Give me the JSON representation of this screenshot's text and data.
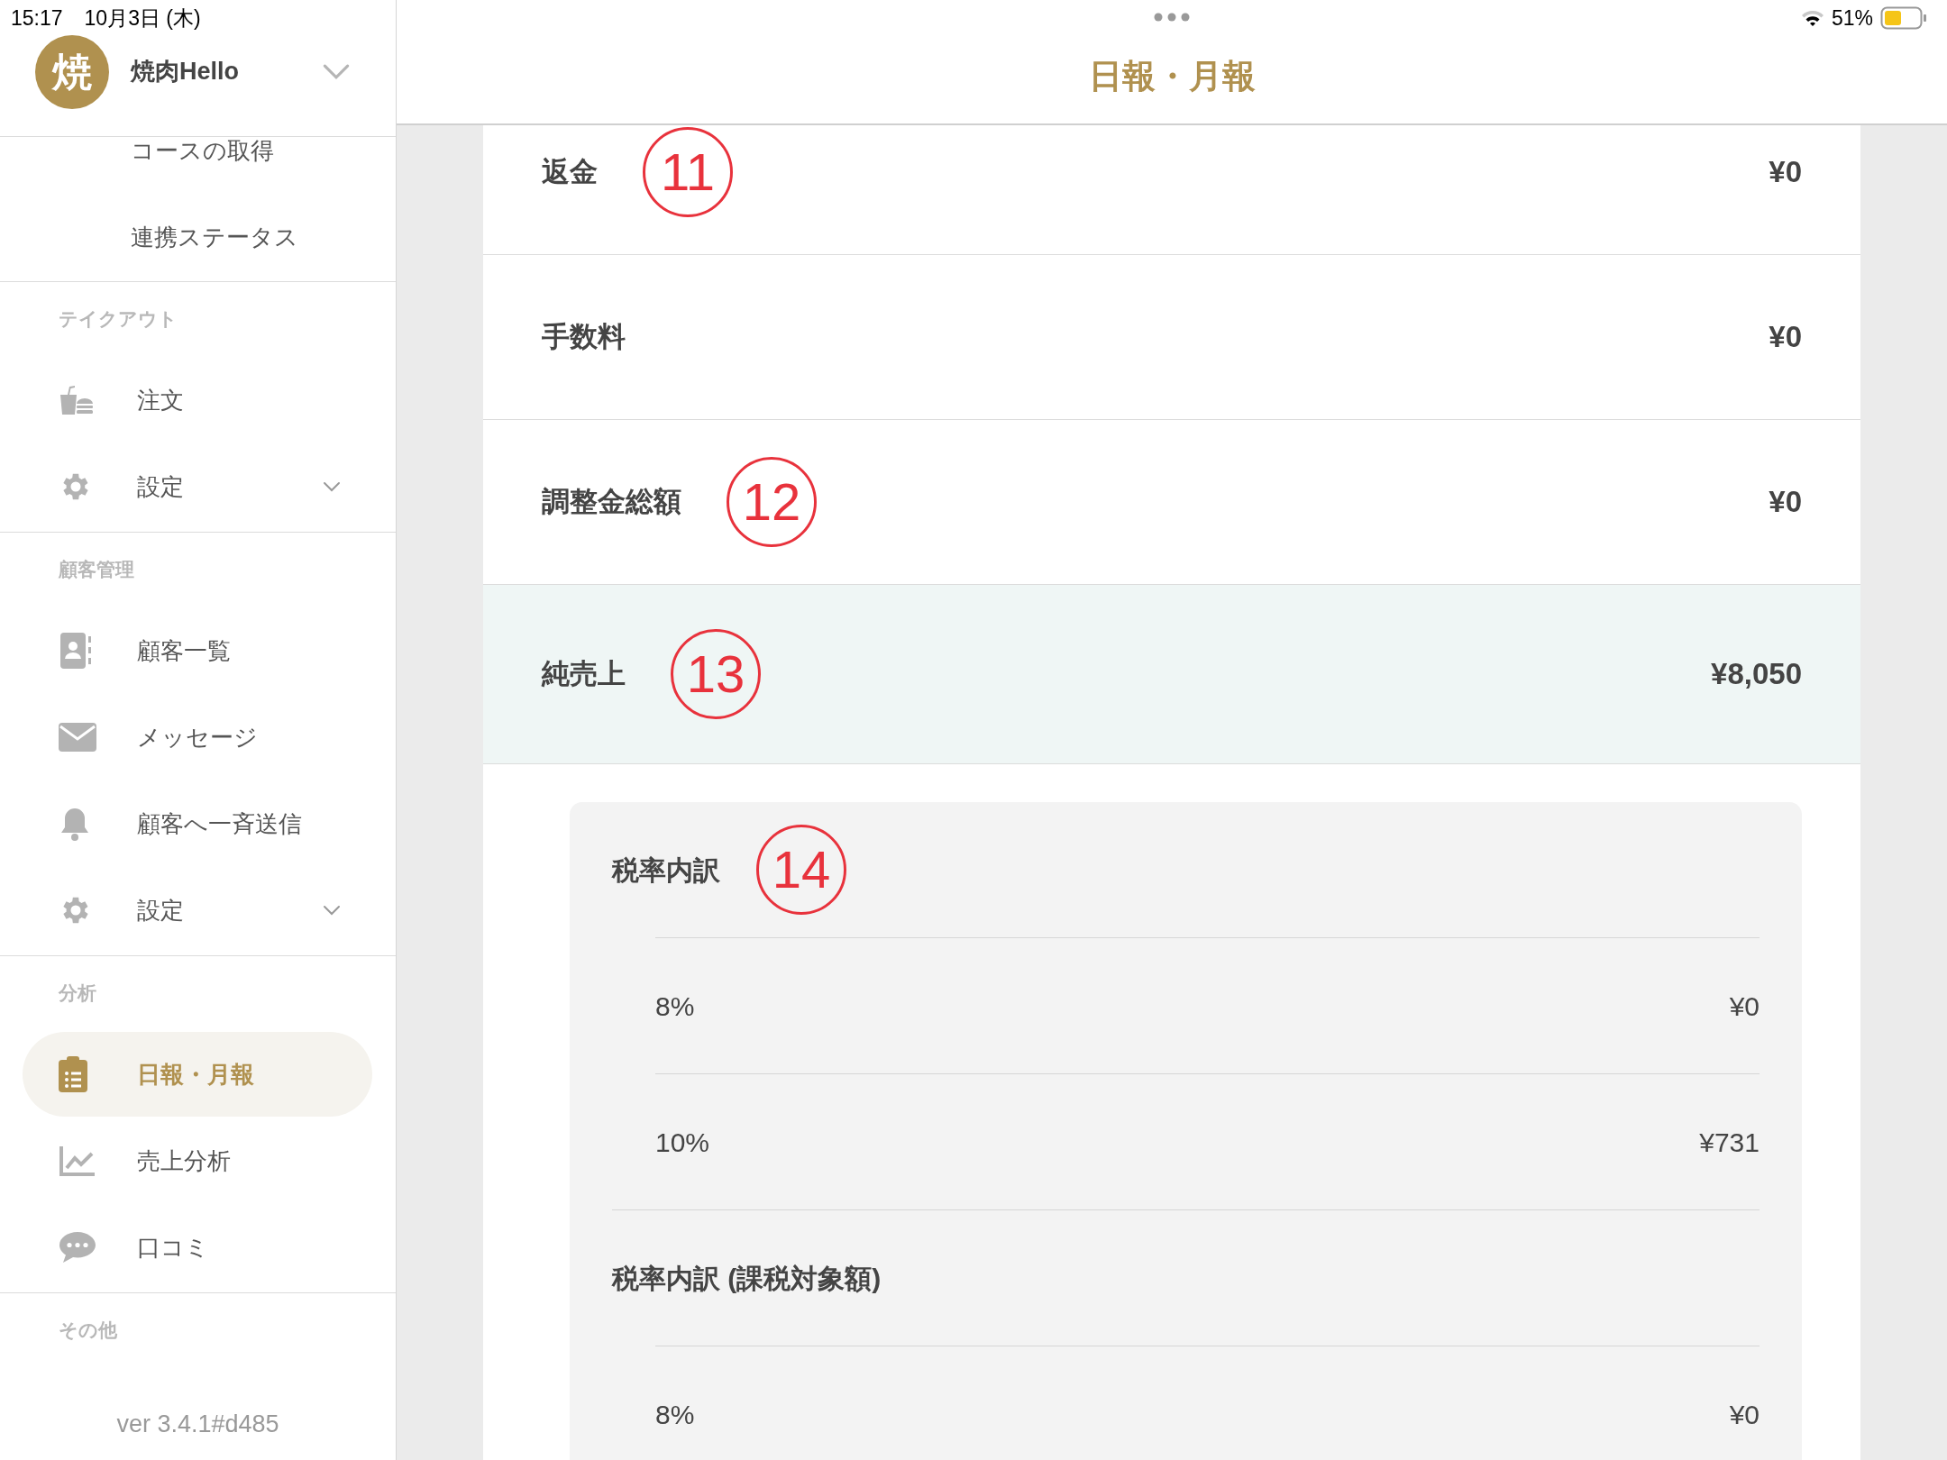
{
  "status_bar": {
    "time": "15:17",
    "date": "10月3日 (木)",
    "battery": "51%"
  },
  "sidebar": {
    "account": {
      "avatar": "焼",
      "name": "焼肉Hello"
    },
    "top_items": [
      {
        "label": "コースの取得"
      },
      {
        "label": "連携ステータス"
      }
    ],
    "sections": [
      {
        "title": "テイクアウト",
        "items": [
          {
            "label": "注文",
            "kind": "link",
            "selected": false
          },
          {
            "label": "設定",
            "kind": "expandable",
            "selected": false
          }
        ]
      },
      {
        "title": "顧客管理",
        "items": [
          {
            "label": "顧客一覧",
            "kind": "link",
            "selected": false
          },
          {
            "label": "メッセージ",
            "kind": "link",
            "selected": false
          },
          {
            "label": "顧客へ一斉送信",
            "kind": "link",
            "selected": false
          },
          {
            "label": "設定",
            "kind": "expandable",
            "selected": false
          }
        ]
      },
      {
        "title": "分析",
        "items": [
          {
            "label": "日報・月報",
            "kind": "link",
            "selected": true
          },
          {
            "label": "売上分析",
            "kind": "link",
            "selected": false
          },
          {
            "label": "口コミ",
            "kind": "link",
            "selected": false
          }
        ]
      },
      {
        "title": "その他"
      }
    ],
    "version": "ver 3.4.1#d485"
  },
  "header": {
    "title": "日報・月報"
  },
  "rows": [
    {
      "label": "返金",
      "value": "¥0",
      "highlighted": false,
      "marker": "11"
    },
    {
      "label": "手数料",
      "value": "¥0",
      "highlighted": false
    },
    {
      "label": "調整金総額",
      "value": "¥0",
      "highlighted": false,
      "marker": "12"
    },
    {
      "label": "純売上",
      "value": "¥8,050",
      "highlighted": true,
      "marker": "13"
    }
  ],
  "tax_card": {
    "sections": [
      {
        "title": "税率内訳",
        "marker": "14",
        "rows": [
          {
            "rate": "8%",
            "amount": "¥0"
          },
          {
            "rate": "10%",
            "amount": "¥731"
          }
        ]
      },
      {
        "title": "税率内訳 (課税対象額)",
        "rows": [
          {
            "rate": "8%",
            "amount": "¥0"
          }
        ]
      }
    ]
  }
}
